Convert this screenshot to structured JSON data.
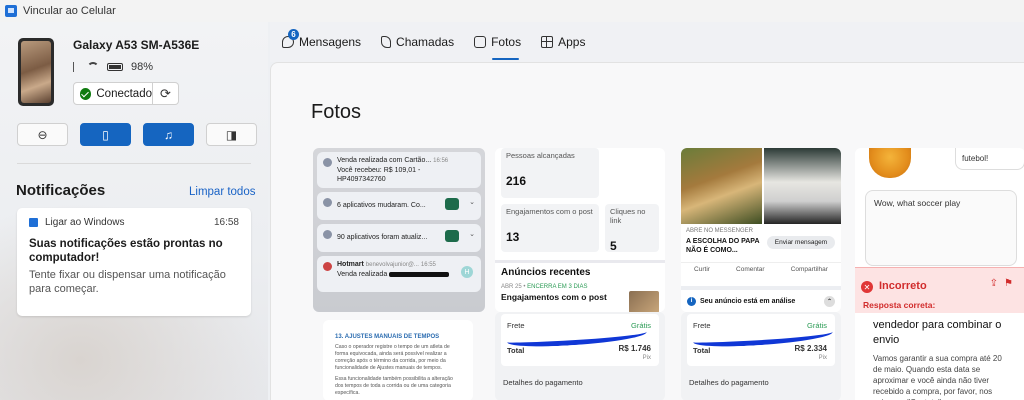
{
  "window": {
    "title": "Vincular ao Celular"
  },
  "device": {
    "name": "Galaxy A53 SM-A536E",
    "battery": "98%",
    "connection_label": "Conectado"
  },
  "quick_actions": [
    {
      "name": "do-not-disturb",
      "glyph": "⊖",
      "active": false
    },
    {
      "name": "vibrate",
      "glyph": "▯",
      "active": true
    },
    {
      "name": "media",
      "glyph": "♫",
      "active": true
    },
    {
      "name": "audio-output",
      "glyph": "◨",
      "active": false
    }
  ],
  "notifications": {
    "title": "Notificações",
    "clear_all": "Limpar todos",
    "items": [
      {
        "app": "Ligar ao Windows",
        "time": "16:58",
        "title": "Suas notificações estão prontas no computador!",
        "body": "Tente fixar ou dispensar uma notificação para começar."
      }
    ]
  },
  "tabs": [
    {
      "label": "Mensagens",
      "badge": "6",
      "icon": "chat-icon"
    },
    {
      "label": "Chamadas",
      "icon": "phone-call-icon"
    },
    {
      "label": "Fotos",
      "icon": "photo-icon",
      "active": true
    },
    {
      "label": "Apps",
      "icon": "apps-grid-icon"
    }
  ],
  "photos": {
    "title": "Fotos",
    "shot1": {
      "rows": [
        {
          "title": "Venda realizada com Cartão...",
          "time": "16:56",
          "line2": "Você recebeu: R$ 109,01 -",
          "line3": "HP4097342760"
        },
        {
          "title": "6 aplicativos mudaram. Co..."
        },
        {
          "title": "90 aplicativos foram atualiz..."
        },
        {
          "title": "Hotmart",
          "sub": "benevolvajunior@...",
          "time": "16:55",
          "line2": "Venda realizada"
        }
      ]
    },
    "shot2": {
      "reach_label": "Pessoas alcançadas",
      "reach": "216",
      "engagement_label": "Engajamentos com o post",
      "engagement": "13",
      "clicks_label": "Cliques no link",
      "clicks": "5",
      "ads_title": "Anúncios recentes",
      "ads_date": "ABR 25 •",
      "ads_status": "ENCERRA EM 3 DIAS",
      "ads_item": "Engajamentos com o post"
    },
    "shot3": {
      "messenger_label": "ABRE NO MESSENGER",
      "caption": "A ESCOLHA DO PAPA NÃO É COMO...",
      "send_button": "Enviar mensagem",
      "like": "Curtir",
      "comment": "Comentar",
      "share": "Compartilhar",
      "analysis": "Seu anúncio está em análise"
    },
    "shot4": {
      "bubble_top": "futebol!",
      "bubble_main": "Wow, what soccer play"
    },
    "quiz": {
      "status": "Incorreto",
      "answer_label": "Resposta correta:",
      "answer_big": "vendedor para combinar o envio",
      "answer_small": "Vamos garantir a sua compra até 20 de maio. Quando esta data se aproximar e você ainda não tiver recebido a compra, por favor, nos avise em \"Contato\"."
    },
    "shot5": {
      "heading": "13. AJUSTES MANUAIS DE TEMPOS",
      "p1": "Caso o operador registre o tempo de um atleta de forma equivocada, ainda será possível realizar a correção após o término da corrida, por meio da funcionalidade de Ajustes manuais de tempos.",
      "p2": "Essa funcionalidade também possibilita a alteração dos tempos de toda a corrida ou de uma categoria específica."
    },
    "pay1": {
      "frete": "Frete",
      "gratis": "Grátis",
      "total": "Total",
      "value": "R$ 1.746",
      "method": "Pix",
      "details": "Detalhes do pagamento"
    },
    "pay2": {
      "frete": "Frete",
      "gratis": "Grátis",
      "total": "Total",
      "value": "R$ 2.334",
      "method": "Pix",
      "details": "Detalhes do pagamento"
    }
  }
}
